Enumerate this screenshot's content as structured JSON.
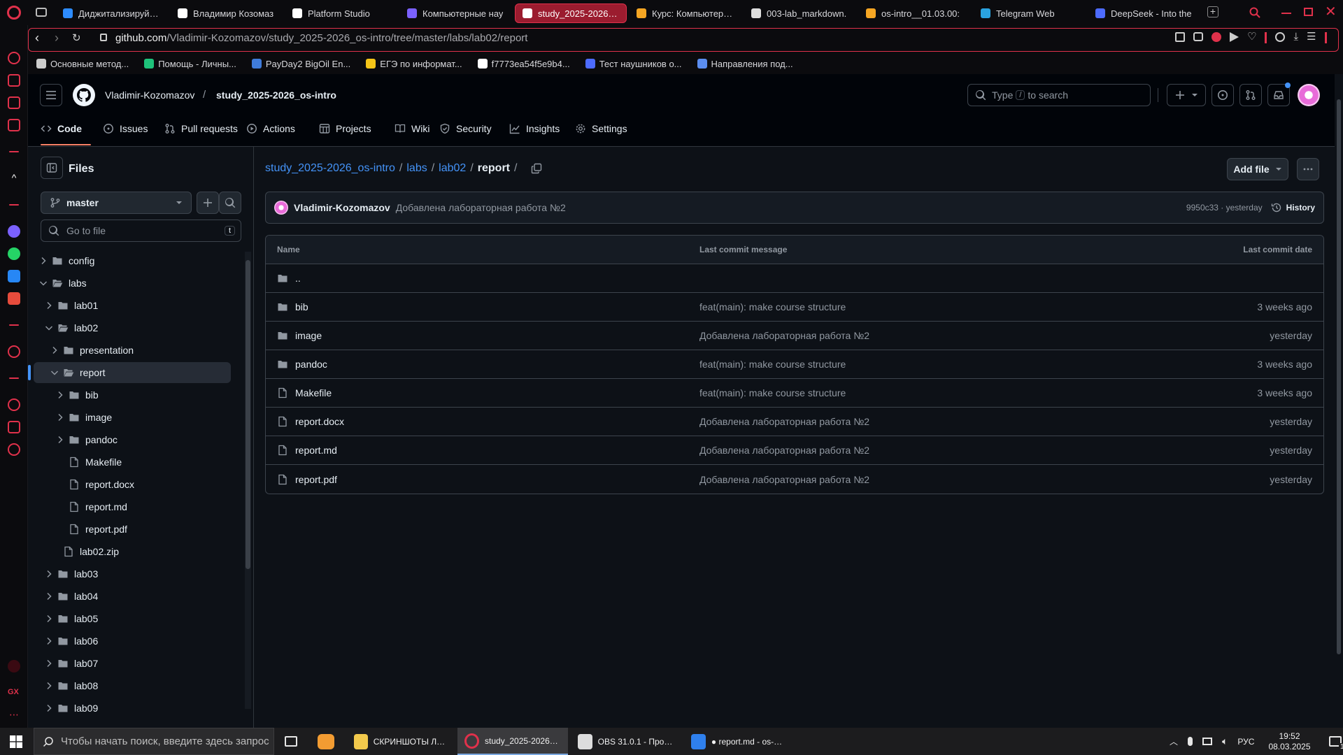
{
  "browser": {
    "tabs": [
      {
        "title": "Диджитализируй —",
        "color": "#2d8cff"
      },
      {
        "title": "Владимир Козомаз",
        "color": "#ffffff"
      },
      {
        "title": "Platform Studio",
        "color": "#ffffff"
      },
      {
        "title": "Компьютерные нау",
        "color": "#7b61ff"
      },
      {
        "title": "study_2025-2026_os-intro",
        "color": "#ffffff"
      },
      {
        "title": "Курс: Компьютерны",
        "color": "#f5a623"
      },
      {
        "title": "003-lab_markdown.",
        "color": "#dddddd"
      },
      {
        "title": "os-intro__01.03.00:",
        "color": "#f5a623"
      },
      {
        "title": "Telegram Web",
        "color": "#2aa3e0"
      },
      {
        "title": "DeepSeek - Into the",
        "color": "#4d6bfe"
      }
    ],
    "url_host": "github.com",
    "url_path": "/Vladimir-Kozomazov/study_2025-2026_os-intro/tree/master/labs/lab02/report",
    "bookmarks": [
      {
        "label": "Основные метод...",
        "color": "#cccccc"
      },
      {
        "label": "Помощь - Личны...",
        "color": "#1ec27a"
      },
      {
        "label": "PayDay2 BigOil En...",
        "color": "#3f7bd9"
      },
      {
        "label": "ЕГЭ по информат...",
        "color": "#f5c518"
      },
      {
        "label": "f7773ea54f5e9b4...",
        "color": "#ffffff"
      },
      {
        "label": "Тест наушников о...",
        "color": "#4d6bfe"
      },
      {
        "label": "Направления под...",
        "color": "#5b8def"
      }
    ]
  },
  "github": {
    "owner": "Vladimir-Kozomazov",
    "repo": "study_2025-2026_os-intro",
    "search_placeholder_pre": "Type",
    "search_key": "/",
    "search_placeholder_post": "to search",
    "nav": [
      {
        "label": "Code",
        "icon": "code-icon"
      },
      {
        "label": "Issues",
        "icon": "issue-icon"
      },
      {
        "label": "Pull requests",
        "icon": "pull-request-icon"
      },
      {
        "label": "Actions",
        "icon": "play-icon"
      },
      {
        "label": "Projects",
        "icon": "table-icon"
      },
      {
        "label": "Wiki",
        "icon": "book-icon"
      },
      {
        "label": "Security",
        "icon": "shield-icon"
      },
      {
        "label": "Insights",
        "icon": "graph-icon"
      },
      {
        "label": "Settings",
        "icon": "gear-icon"
      }
    ]
  },
  "files_panel": {
    "title": "Files",
    "branch": "master",
    "goto_placeholder": "Go to file",
    "goto_key": "t",
    "tree": [
      {
        "label": "config",
        "type": "folder",
        "depth": 0,
        "expanded": false
      },
      {
        "label": "labs",
        "type": "folder-open",
        "depth": 0,
        "expanded": true
      },
      {
        "label": "lab01",
        "type": "folder",
        "depth": 1,
        "expanded": false
      },
      {
        "label": "lab02",
        "type": "folder-open",
        "depth": 1,
        "expanded": true
      },
      {
        "label": "presentation",
        "type": "folder",
        "depth": 2,
        "expanded": false
      },
      {
        "label": "report",
        "type": "folder-open",
        "depth": 2,
        "expanded": true,
        "selected": true
      },
      {
        "label": "bib",
        "type": "folder",
        "depth": 3,
        "expanded": false
      },
      {
        "label": "image",
        "type": "folder",
        "depth": 3,
        "expanded": false
      },
      {
        "label": "pandoc",
        "type": "folder",
        "depth": 3,
        "expanded": false
      },
      {
        "label": "Makefile",
        "type": "file",
        "depth": 3
      },
      {
        "label": "report.docx",
        "type": "file",
        "depth": 3
      },
      {
        "label": "report.md",
        "type": "file",
        "depth": 3
      },
      {
        "label": "report.pdf",
        "type": "file",
        "depth": 3
      },
      {
        "label": "lab02.zip",
        "type": "file",
        "depth": 2
      },
      {
        "label": "lab03",
        "type": "folder",
        "depth": 1,
        "expanded": false
      },
      {
        "label": "lab04",
        "type": "folder",
        "depth": 1,
        "expanded": false
      },
      {
        "label": "lab05",
        "type": "folder",
        "depth": 1,
        "expanded": false
      },
      {
        "label": "lab06",
        "type": "folder",
        "depth": 1,
        "expanded": false
      },
      {
        "label": "lab07",
        "type": "folder",
        "depth": 1,
        "expanded": false
      },
      {
        "label": "lab08",
        "type": "folder",
        "depth": 1,
        "expanded": false
      },
      {
        "label": "lab09",
        "type": "folder",
        "depth": 1,
        "expanded": false
      }
    ]
  },
  "breadcrumb": {
    "repo": "study_2025-2026_os-intro",
    "sep": "/",
    "labs": "labs",
    "lab02": "lab02",
    "current": "report",
    "trail": "/"
  },
  "add_file_label": "Add file",
  "commit": {
    "author": "Vladimir-Kozomazov",
    "message": "Добавлена лабораторная работа №2",
    "meta": "9950c33 · yesterday",
    "history_label": "History"
  },
  "table": {
    "headers": {
      "name": "Name",
      "message": "Last commit message",
      "date": "Last commit date"
    },
    "parent": "..",
    "rows": [
      {
        "name": "bib",
        "type": "folder",
        "message": "feat(main): make course structure",
        "date": "3 weeks ago"
      },
      {
        "name": "image",
        "type": "folder",
        "message": "Добавлена лабораторная работа №2",
        "date": "yesterday"
      },
      {
        "name": "pandoc",
        "type": "folder",
        "message": "feat(main): make course structure",
        "date": "3 weeks ago"
      },
      {
        "name": "Makefile",
        "type": "file",
        "message": "feat(main): make course structure",
        "date": "3 weeks ago"
      },
      {
        "name": "report.docx",
        "type": "file",
        "message": "Добавлена лабораторная работа №2",
        "date": "yesterday"
      },
      {
        "name": "report.md",
        "type": "file",
        "message": "Добавлена лабораторная работа №2",
        "date": "yesterday"
      },
      {
        "name": "report.pdf",
        "type": "file",
        "message": "Добавлена лабораторная работа №2",
        "date": "yesterday"
      }
    ]
  },
  "taskbar": {
    "search_placeholder": "Чтобы начать поиск, введите здесь запрос",
    "apps": [
      {
        "label": "СКРИНШОТЫ ЛАБ 3",
        "color": "#f2c94c"
      },
      {
        "label": "study_2025-2026_o...",
        "color": "#e0314b"
      },
      {
        "label": "OBS 31.0.1 - Проф...",
        "color": "#dddddd"
      },
      {
        "label": "● report.md - os-in...",
        "color": "#2f80ed"
      }
    ],
    "lang": "РУС",
    "time": "19:52",
    "date": "08.03.2025",
    "notifications": "1"
  },
  "colors": {
    "accent_red": "#e0314b",
    "link_blue": "#4493f8",
    "nav_underline": "#f78166"
  }
}
